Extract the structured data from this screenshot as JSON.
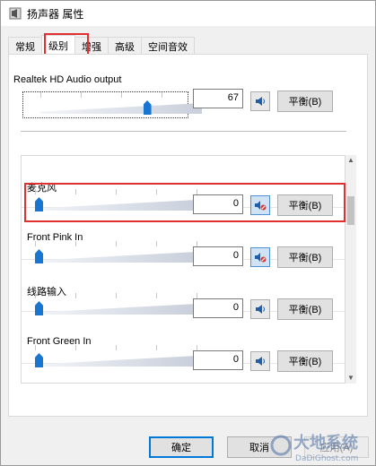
{
  "window": {
    "title": "扬声器 属性"
  },
  "tabs": [
    {
      "label": "常规"
    },
    {
      "label": "级别"
    },
    {
      "label": "增强"
    },
    {
      "label": "高级"
    },
    {
      "label": "空间音效"
    }
  ],
  "main_device": {
    "label": "Realtek HD Audio output",
    "value": "67",
    "level": 0.67,
    "muted": false,
    "balance_label": "平衡(B)"
  },
  "devices": [
    {
      "label": "麦克风",
      "value": "0",
      "level": 0,
      "muted": true,
      "balance_label": "平衡(B)"
    },
    {
      "label": "Front Pink In",
      "value": "0",
      "level": 0,
      "muted": true,
      "balance_label": "平衡(B)"
    },
    {
      "label": "线路输入",
      "value": "0",
      "level": 0,
      "muted": false,
      "balance_label": "平衡(B)"
    },
    {
      "label": "Front Green In",
      "value": "0",
      "level": 0,
      "muted": false,
      "balance_label": "平衡(B)"
    }
  ],
  "footer": {
    "ok_label": "确定",
    "cancel_label": "取消",
    "apply_label": "应用(A)"
  },
  "watermark": {
    "text": "大地系统",
    "subtext": "DaDiGhost.com"
  },
  "colors": {
    "accent": "#1875d1",
    "highlight": "#e03030"
  }
}
